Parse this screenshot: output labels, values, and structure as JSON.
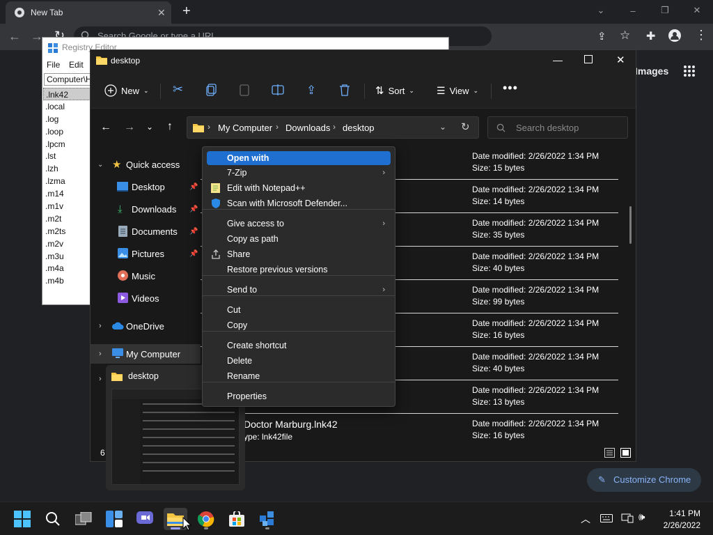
{
  "chrome": {
    "tab_title": "New Tab",
    "omnibox_placeholder": "Search Google or type a URL",
    "images_link": "Images",
    "customize_label": "Customize Chrome"
  },
  "regedit": {
    "title": "Registry Editor",
    "menu": [
      "File",
      "Edit"
    ],
    "path": "Computer\\HKEY_CLASSES_ROOT",
    "keys": [
      ".lnk42",
      ".local",
      ".log",
      ".loop",
      ".lpcm",
      ".lst",
      ".lzh",
      ".lzma",
      ".m14",
      ".m1v",
      ".m2t",
      ".m2ts",
      ".m2v",
      ".m3u",
      ".m4a",
      ".m4b"
    ]
  },
  "explorer": {
    "title": "desktop",
    "cmd": {
      "new": "New",
      "sort": "Sort",
      "view": "View"
    },
    "breadcrumb": [
      "My Computer",
      "Downloads",
      "desktop"
    ],
    "search_placeholder": "Search desktop",
    "nav": {
      "quick_access": "Quick access",
      "desktop": "Desktop",
      "downloads": "Downloads",
      "documents": "Documents",
      "pictures": "Pictures",
      "music": "Music",
      "videos": "Videos",
      "onedrive": "OneDrive",
      "my_computer": "My Computer"
    },
    "files": [
      {
        "name": "",
        "type": "",
        "date": "Date modified: 2/26/2022 1:34 PM",
        "size": "Size: 15 bytes"
      },
      {
        "name": "",
        "type": "",
        "date": "Date modified: 2/26/2022 1:34 PM",
        "size": "Size: 14 bytes"
      },
      {
        "name": "",
        "type": "",
        "date": "Date modified: 2/26/2022 1:34 PM",
        "size": "Size: 35 bytes"
      },
      {
        "name": "",
        "type": "",
        "date": "Date modified: 2/26/2022 1:34 PM",
        "size": "Size: 40 bytes"
      },
      {
        "name": "",
        "type": "",
        "date": "Date modified: 2/26/2022 1:34 PM",
        "size": "Size: 99 bytes"
      },
      {
        "name": "",
        "type": "",
        "date": "Date modified: 2/26/2022 1:34 PM",
        "size": "Size: 16 bytes"
      },
      {
        "name": "",
        "type": "",
        "date": "Date modified: 2/26/2022 1:34 PM",
        "size": "Size: 40 bytes"
      },
      {
        "name": "",
        "type": "",
        "date": "Date modified: 2/26/2022 1:34 PM",
        "size": "Size: 13 bytes"
      },
      {
        "name": "Doctor Marburg.lnk42",
        "type": "ype: lnk42file",
        "date": "Date modified: 2/26/2022 1:34 PM",
        "size": "Size: 16 bytes"
      }
    ],
    "status_count": "6"
  },
  "context_menu": {
    "items": [
      {
        "label": "Open with",
        "highlighted": true
      },
      {
        "label": "7-Zip",
        "submenu": true
      },
      {
        "label": "Edit with Notepad++",
        "icon": "notepad-plus-plus-icon"
      },
      {
        "label": "Scan with Microsoft Defender...",
        "icon": "defender-shield-icon"
      },
      {
        "label": "Give access to",
        "submenu": true
      },
      {
        "label": "Copy as path"
      },
      {
        "label": "Share",
        "icon": "share-icon"
      },
      {
        "label": "Restore previous versions"
      },
      {
        "label": "Send to",
        "submenu": true
      },
      {
        "label": "Cut"
      },
      {
        "label": "Copy"
      },
      {
        "label": "Create shortcut"
      },
      {
        "label": "Delete"
      },
      {
        "label": "Rename"
      },
      {
        "label": "Properties"
      }
    ]
  },
  "thumbnail": {
    "title": "desktop"
  },
  "taskbar": {
    "time": "1:41 PM",
    "date": "2/26/2022"
  },
  "colors": {
    "accent": "#1f6fd1",
    "folder": "#f4c542",
    "taskbar": "#1c1c1c",
    "explorer_bg": "#191919",
    "link_blue": "#8ab4f8"
  }
}
